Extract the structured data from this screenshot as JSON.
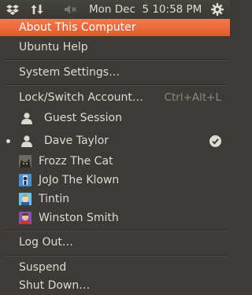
{
  "panel": {
    "datetime": "Mon Dec  5 10:58 PM",
    "icons": [
      "dropbox-icon",
      "network-transfer-icon",
      "volume-muted-icon",
      "session-gear-icon"
    ]
  },
  "menu": {
    "about": "About This Computer",
    "help": "Ubuntu Help",
    "settings": "System Settings…",
    "lock": "Lock/Switch Account…",
    "lock_accel": "Ctrl+Alt+L",
    "guest": "Guest Session",
    "users": [
      {
        "name": "Dave Taylor",
        "active": true,
        "icon": "person-icon"
      },
      {
        "name": "Frozz The Cat",
        "icon": "cat-avatar"
      },
      {
        "name": "JoJo The Klown",
        "icon": "clown-avatar"
      },
      {
        "name": "Tintin",
        "icon": "tintin-avatar"
      },
      {
        "name": "Winston Smith",
        "icon": "winston-avatar"
      }
    ],
    "logout": "Log Out…",
    "suspend": "Suspend",
    "shutdown": "Shut Down…"
  },
  "colors": {
    "highlight": "#e9632f",
    "menu_bg": "#3c3b37",
    "text": "#dfdbd2"
  }
}
